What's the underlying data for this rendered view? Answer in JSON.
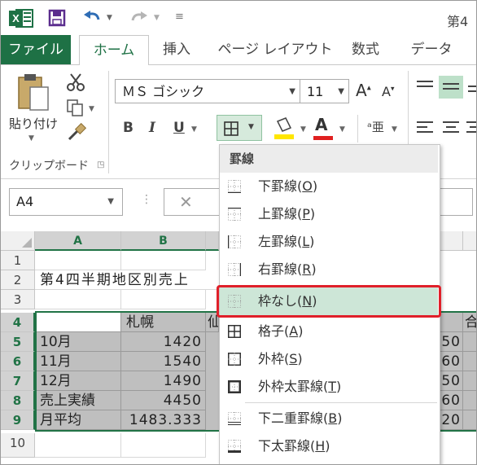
{
  "window": {
    "title": "第4"
  },
  "tabs": [
    {
      "label": "ファイル"
    },
    {
      "label": "ホーム"
    },
    {
      "label": "挿入"
    },
    {
      "label": "ページ レイアウト"
    },
    {
      "label": "数式"
    },
    {
      "label": "データ"
    }
  ],
  "ribbon": {
    "paste_label": "貼り付け",
    "clipboard_label": "クリップボード",
    "font_name": "ＭＳ ゴシック",
    "font_size": "11",
    "bold": "B",
    "italic": "I",
    "underline": "U",
    "font_color_letter": "A"
  },
  "formula_bar": {
    "name_box": "A4"
  },
  "columns": [
    "A",
    "B"
  ],
  "rows": [
    "1",
    "2",
    "3",
    "4",
    "5",
    "6",
    "7",
    "8",
    "9",
    "10"
  ],
  "cells": {
    "a2": "第4四半期地区別売上",
    "b4": "札幌",
    "c4": "仙",
    "a5": "10月",
    "b5": "1420",
    "a6": "11月",
    "b6": "1540",
    "a7": "12月",
    "b7": "1490",
    "a8": "売上実績",
    "b8": "4450",
    "a9": "月平均",
    "b9": "1483.333",
    "right_col": [
      "50",
      "60",
      "50",
      "60",
      "20"
    ],
    "right_head": "合"
  },
  "border_menu": {
    "header": "罫線",
    "items": [
      {
        "label": "下罫線(O)",
        "base": "下罫線(",
        "key": "O"
      },
      {
        "label": "上罫線(P)",
        "base": "上罫線(",
        "key": "P"
      },
      {
        "label": "左罫線(L)",
        "base": "左罫線(",
        "key": "L"
      },
      {
        "label": "右罫線(R)",
        "base": "右罫線(",
        "key": "R"
      },
      {
        "label": "枠なし(N)",
        "base": "枠なし(",
        "key": "N"
      },
      {
        "label": "格子(A)",
        "base": "格子(",
        "key": "A"
      },
      {
        "label": "外枠(S)",
        "base": "外枠(",
        "key": "S"
      },
      {
        "label": "外枠太罫線(T)",
        "base": "外枠太罫線(",
        "key": "T"
      },
      {
        "label": "下二重罫線(B)",
        "base": "下二重罫線(",
        "key": "B"
      },
      {
        "label": "下太罫線(H)",
        "base": "下太罫線(",
        "key": "H"
      }
    ]
  },
  "colors": {
    "excel_green": "#1e7145",
    "highlight": "#cde6d7",
    "callout_red": "#e0202a",
    "selection_gray": "#bfbfbf"
  }
}
